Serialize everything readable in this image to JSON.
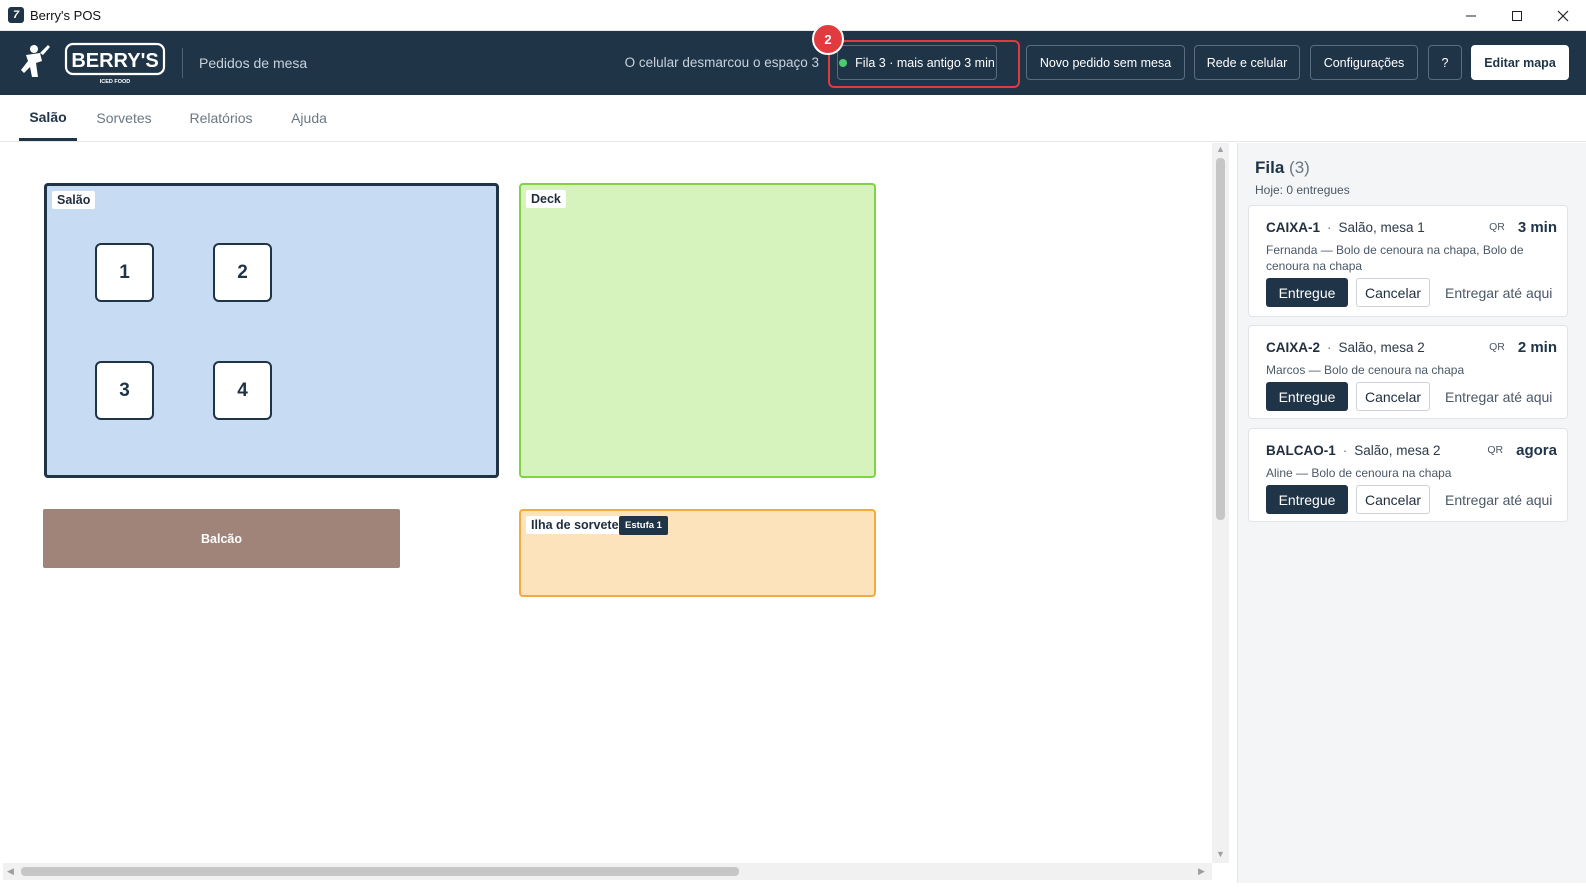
{
  "window": {
    "title": "Berry's POS",
    "icon_glyph": "7"
  },
  "header": {
    "logo_text": "BERRY'S",
    "logo_subtext": "ICED FOOD",
    "section": "Pedidos de mesa",
    "phone_status": "O celular desmarcou o espaço 3",
    "queue_button": "Fila 3 · mais antigo 3 min",
    "queue_badge": "2",
    "new_order_button": "Novo pedido sem mesa",
    "network_button": "Rede e celular",
    "config_button": "Configurações",
    "help_button": "?",
    "edit_map_button": "Editar mapa"
  },
  "tabs": [
    {
      "label": "Salão",
      "active": true
    },
    {
      "label": "Sorvetes",
      "active": false
    },
    {
      "label": "Relatórios",
      "active": false
    },
    {
      "label": "Ajuda",
      "active": false
    }
  ],
  "map": {
    "zones": {
      "salao": "Salão",
      "deck": "Deck",
      "balcao": "Balcão",
      "ilha": "Ilha de sorvete",
      "ilha_tag": "Estufa 1"
    },
    "tables": [
      "1",
      "2",
      "3",
      "4"
    ]
  },
  "queue": {
    "title": "Fila",
    "count": "(3)",
    "subtitle": "Hoje: 0 entregues",
    "orders": [
      {
        "id": "CAIXA-1",
        "location": "Salão, mesa 1",
        "source": "QR",
        "age": "3 min",
        "details": "Fernanda  —  Bolo de cenoura na chapa, Bolo de cenoura na chapa",
        "deliver": "Entregue",
        "cancel": "Cancelar",
        "deliver_here": "Entregar até aqui"
      },
      {
        "id": "CAIXA-2",
        "location": "Salão, mesa 2",
        "source": "QR",
        "age": "2 min",
        "details": "Marcos  —  Bolo de cenoura na chapa",
        "deliver": "Entregue",
        "cancel": "Cancelar",
        "deliver_here": "Entregar até aqui"
      },
      {
        "id": "BALCAO-1",
        "location": "Salão, mesa 2",
        "source": "QR",
        "age": "agora",
        "details": "Aline  —  Bolo de cenoura na chapa",
        "deliver": "Entregue",
        "cancel": "Cancelar",
        "deliver_here": "Entregar até aqui"
      }
    ]
  },
  "colors": {
    "brand": "#1f3447",
    "alert": "#e23b3f",
    "status_ok": "#4ccb6e"
  }
}
